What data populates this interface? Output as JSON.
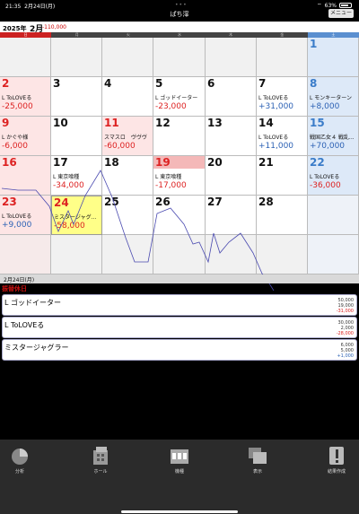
{
  "status": {
    "time": "21:35",
    "date": "2月24日(月)",
    "battery": "63%"
  },
  "nav": {
    "title": "ぱち滓",
    "menu": "メニュー"
  },
  "calendar": {
    "year": "2025年",
    "month": "2月",
    "month_total": "-110,000",
    "weekdays": [
      "日",
      "月",
      "火",
      "水",
      "木",
      "金",
      "土"
    ],
    "days": [
      {
        "d": "1"
      },
      {
        "d": "2",
        "m": "L ToLOVEる",
        "a": "-25,000"
      },
      {
        "d": "3"
      },
      {
        "d": "4"
      },
      {
        "d": "5",
        "m": "L ゴッドイーター",
        "a": "-23,000"
      },
      {
        "d": "6"
      },
      {
        "d": "7",
        "m": "L ToLOVEる",
        "a": "+31,000"
      },
      {
        "d": "8",
        "m": "L モンキーターン",
        "a": "+8,000"
      },
      {
        "d": "9",
        "m": "L かぐや様",
        "a": "-6,000"
      },
      {
        "d": "10"
      },
      {
        "d": "11",
        "m": "スマスロ　ヴヴヴ",
        "a": "-60,000"
      },
      {
        "d": "12"
      },
      {
        "d": "13"
      },
      {
        "d": "14",
        "m": "L ToLOVEる",
        "a": "+11,000"
      },
      {
        "d": "15",
        "m": "戦国乙女４ 戦乱...",
        "a": "+70,000"
      },
      {
        "d": "16"
      },
      {
        "d": "17",
        "m": "L 東京喰種",
        "a": "-34,000"
      },
      {
        "d": "18"
      },
      {
        "d": "19",
        "m": "L 東京喰種",
        "a": "-17,000"
      },
      {
        "d": "20"
      },
      {
        "d": "21"
      },
      {
        "d": "22",
        "m": "L ToLOVEる",
        "a": "-36,000"
      },
      {
        "d": "23",
        "m": "L ToLOVEる",
        "a": "+9,000"
      },
      {
        "d": "24",
        "m": "ミスタージャグ...",
        "a": "-58,000"
      },
      {
        "d": "25"
      },
      {
        "d": "26"
      },
      {
        "d": "27"
      },
      {
        "d": "28"
      }
    ]
  },
  "detail": {
    "date": "2月24日(月)",
    "holiday": "振替休日",
    "rows": [
      {
        "name": "L ゴッドイーター",
        "n1": "50,000",
        "n2": "19,000",
        "n3": "-31,000"
      },
      {
        "name": "L ToLOVEる",
        "n1": "30,000",
        "n2": "2,000",
        "n3": "-28,000"
      },
      {
        "name": "ミスタージャグラー",
        "n1": "6,000",
        "n2": "5,000",
        "n3": "+1,000"
      }
    ]
  },
  "tabs": [
    "分析",
    "ホール",
    "機種",
    "表示",
    "結果作成"
  ]
}
